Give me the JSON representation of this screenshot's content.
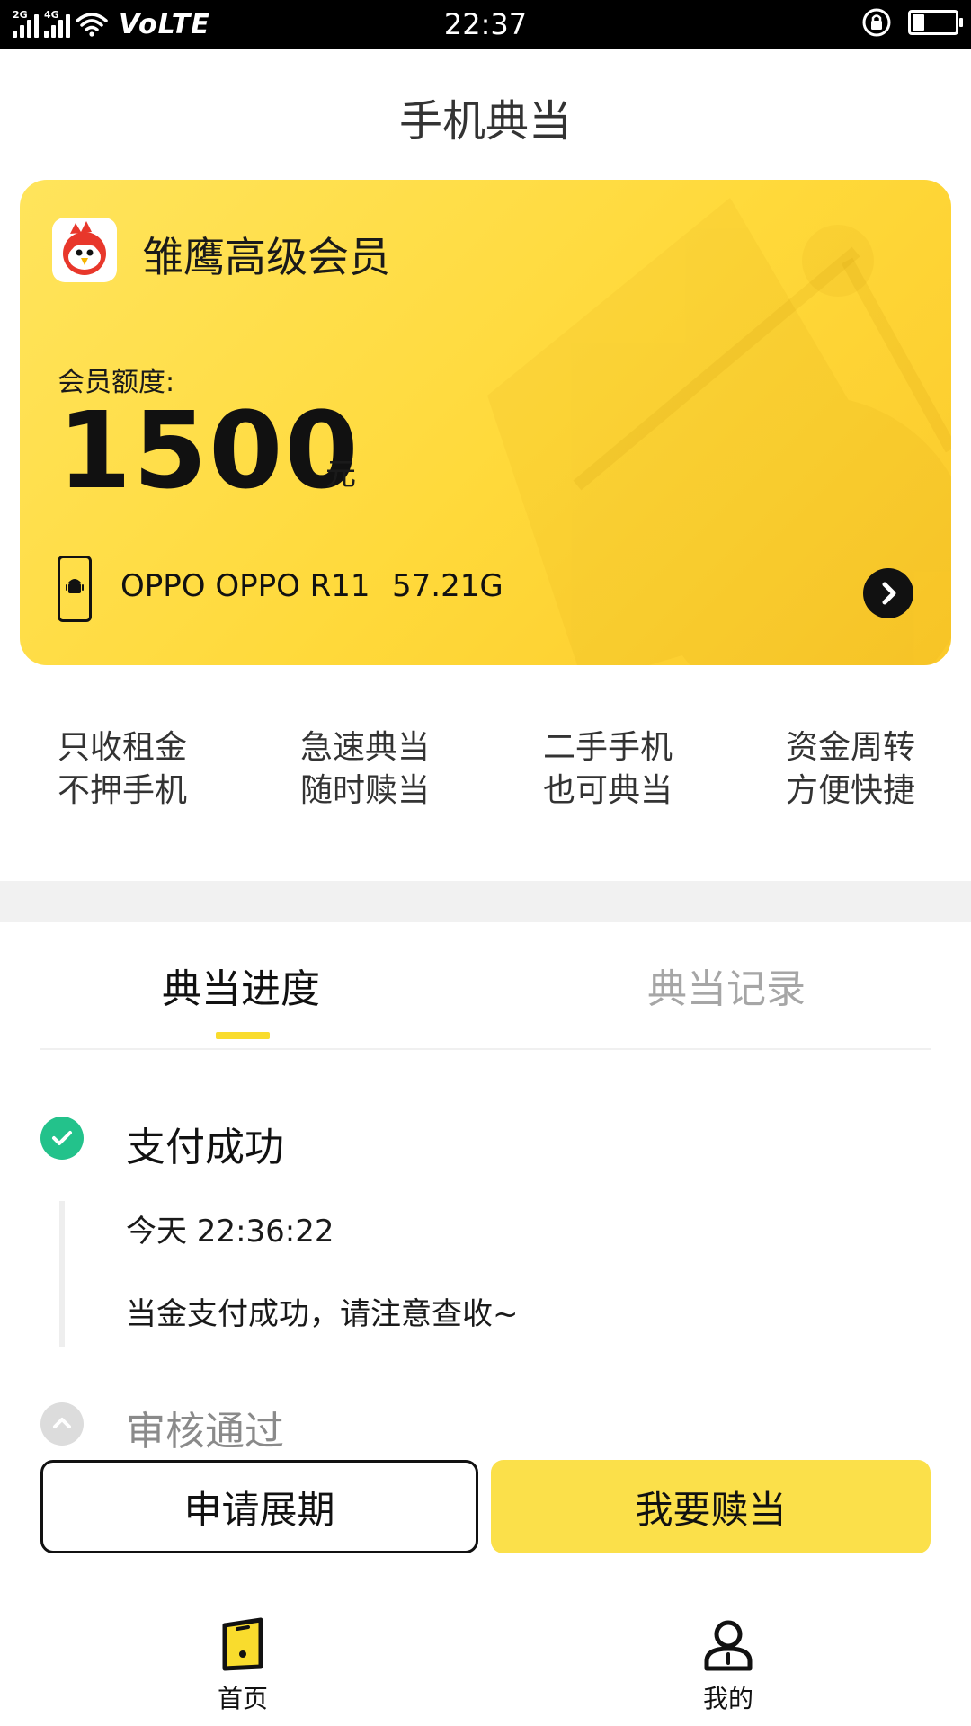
{
  "status_bar": {
    "network_tag_1": "2G",
    "network_tag_2": "4G",
    "carrier_label": "VoLTE",
    "time": "22:37",
    "battery_level": 0.25
  },
  "header": {
    "title": "手机典当"
  },
  "card": {
    "membership_name": "雏鹰高级会员",
    "quota_label": "会员额度:",
    "quota_amount": "1500",
    "quota_unit": "元",
    "device_model": "OPPO OPPO R11",
    "device_storage": "57.21G",
    "accent_color": "#ffd93a"
  },
  "features": [
    {
      "line1": "只收租金",
      "line2": "不押手机"
    },
    {
      "line1": "急速典当",
      "line2": "随时赎当"
    },
    {
      "line1": "二手手机",
      "line2": "也可典当"
    },
    {
      "line1": "资金周转",
      "line2": "方便快捷"
    }
  ],
  "tabs": [
    {
      "label": "典当进度",
      "active": true
    },
    {
      "label": "典当记录",
      "active": false
    }
  ],
  "timeline": [
    {
      "title": "支付成功",
      "status": "done",
      "time": "今天 22:36:22",
      "message": "当金支付成功，请注意查收~"
    },
    {
      "title": "审核通过",
      "status": "collapsed"
    }
  ],
  "actions": {
    "extend_label": "申请展期",
    "redeem_label": "我要赎当"
  },
  "bottom_nav": [
    {
      "label": "首页",
      "icon": "home-phone-icon",
      "active": true
    },
    {
      "label": "我的",
      "icon": "user-icon",
      "active": false
    }
  ]
}
